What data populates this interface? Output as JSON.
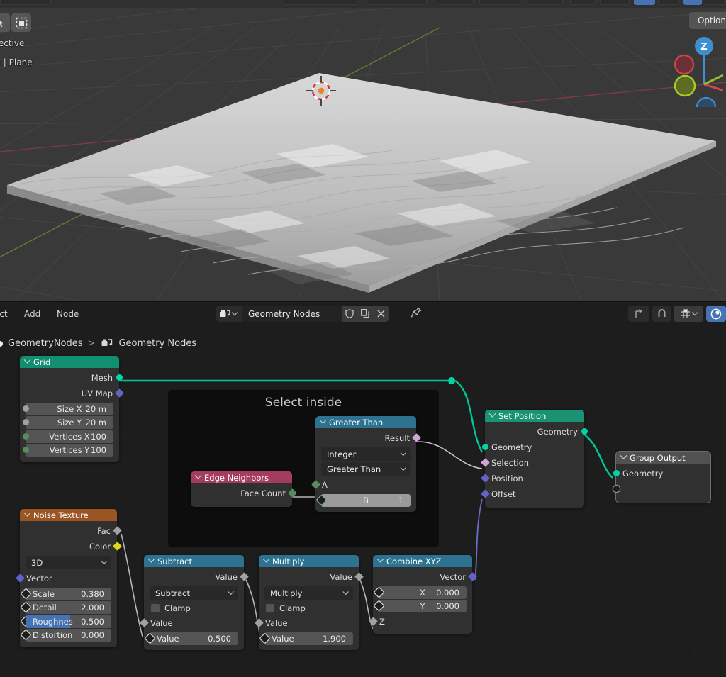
{
  "app": {
    "title": "Blender — Geometry Nodes"
  },
  "viewport": {
    "perspective_label": "spective",
    "collection_label": "tion | Plane",
    "options_button": "Option",
    "gizmo_axis_z": "Z",
    "icons": {
      "select_box": "select-box-icon",
      "cursor_3d": "cursor-3d-icon"
    }
  },
  "node_editor_header": {
    "menus": [
      "ect",
      "Add",
      "Node"
    ],
    "datablock_name": "Geometry Nodes",
    "buttons": {
      "browse": "browse-geometry-nodes-icon",
      "fake_user": "shield-icon",
      "duplicate": "copy-icon",
      "unlink": "x-icon",
      "pin": "pin-icon",
      "parent": "up-arrow-icon",
      "snap_magnet": "magnet-icon",
      "snap_mode": "snap-grid-icon",
      "snap_chevron": "chevron-down-icon",
      "overlays": "overlays-icon"
    }
  },
  "breadcrumb": {
    "object": "GeometryNodes",
    "separator": ">",
    "modifier": "Geometry Nodes",
    "modifier_icon": "geometry-nodes-icon"
  },
  "frames": [
    {
      "label": "Select inside"
    }
  ],
  "nodes": {
    "grid": {
      "title": "Grid",
      "outputs": [
        {
          "label": "Mesh",
          "type": "geometry"
        },
        {
          "label": "UV Map",
          "type": "vector"
        }
      ],
      "props": [
        {
          "label": "Size X",
          "value": "20 m",
          "socket": "value"
        },
        {
          "label": "Size Y",
          "value": "20 m",
          "socket": "value"
        },
        {
          "label": "Vertices X",
          "value": "100",
          "socket": "integer"
        },
        {
          "label": "Vertices Y",
          "value": "100",
          "socket": "integer"
        }
      ]
    },
    "noise_texture": {
      "title": "Noise Texture",
      "outputs": [
        {
          "label": "Fac",
          "type": "value"
        },
        {
          "label": "Color",
          "type": "color"
        }
      ],
      "dimension_select": "3D",
      "vector_input": "Vector",
      "props": [
        {
          "label": "Scale",
          "value": "0.380",
          "slider": 0
        },
        {
          "label": "Detail",
          "value": "2.000",
          "slider": 0
        },
        {
          "label": "Roughnes",
          "value": "0.500",
          "slider": 50
        },
        {
          "label": "Distortion",
          "value": "0.000",
          "slider": 0
        }
      ]
    },
    "edge_neighbors": {
      "title": "Edge Neighbors",
      "outputs": [
        {
          "label": "Face Count",
          "type": "integer"
        }
      ]
    },
    "greater_than": {
      "title": "Greater Than",
      "outputs": [
        {
          "label": "Result",
          "type": "boolean"
        }
      ],
      "data_type": "Integer",
      "operation": "Greater Than",
      "inputs": [
        {
          "label": "A",
          "type": "integer"
        }
      ],
      "value_field": {
        "label": "B",
        "value": "1",
        "highlighted": true
      }
    },
    "subtract": {
      "title": "Subtract",
      "outputs": [
        {
          "label": "Value",
          "type": "value"
        }
      ],
      "operation": "Subtract",
      "clamp_label": "Clamp",
      "clamp_checked": false,
      "input_linked_label": "Value",
      "value_field": {
        "label": "Value",
        "value": "0.500"
      }
    },
    "multiply": {
      "title": "Multiply",
      "outputs": [
        {
          "label": "Value",
          "type": "value"
        }
      ],
      "operation": "Multiply",
      "clamp_label": "Clamp",
      "clamp_checked": false,
      "input_linked_label": "Value",
      "value_field": {
        "label": "Value",
        "value": "1.900"
      }
    },
    "combine_xyz": {
      "title": "Combine XYZ",
      "outputs": [
        {
          "label": "Vector",
          "type": "vector"
        }
      ],
      "props": [
        {
          "label": "X",
          "value": "0.000"
        },
        {
          "label": "Y",
          "value": "0.000"
        }
      ],
      "linked_input": "Z"
    },
    "set_position": {
      "title": "Set Position",
      "outputs": [
        {
          "label": "Geometry",
          "type": "geometry"
        }
      ],
      "inputs": [
        {
          "label": "Geometry",
          "type": "geometry"
        },
        {
          "label": "Selection",
          "type": "boolean"
        },
        {
          "label": "Position",
          "type": "vector"
        },
        {
          "label": "Offset",
          "type": "vector"
        }
      ]
    },
    "group_output": {
      "title": "Group Output",
      "inputs": [
        {
          "label": "Geometry",
          "type": "geometry"
        },
        {
          "label": "",
          "type": "virtual"
        }
      ]
    }
  },
  "colors": {
    "geometry_socket": "#00d6a3",
    "vector_socket": "#6363c7",
    "value_socket": "#a1a1a1",
    "color_socket": "#e0d615",
    "boolean_socket": "#cca6d6",
    "integer_socket": "#598c5c",
    "header_geometry": "#128e71",
    "header_converter": "#2d7391",
    "header_texture": "#9b5522",
    "header_input": "#a33c5f",
    "accent_blue": "#4772b3",
    "canvas_bg": "#1d1d1d",
    "node_bg": "#303030"
  }
}
